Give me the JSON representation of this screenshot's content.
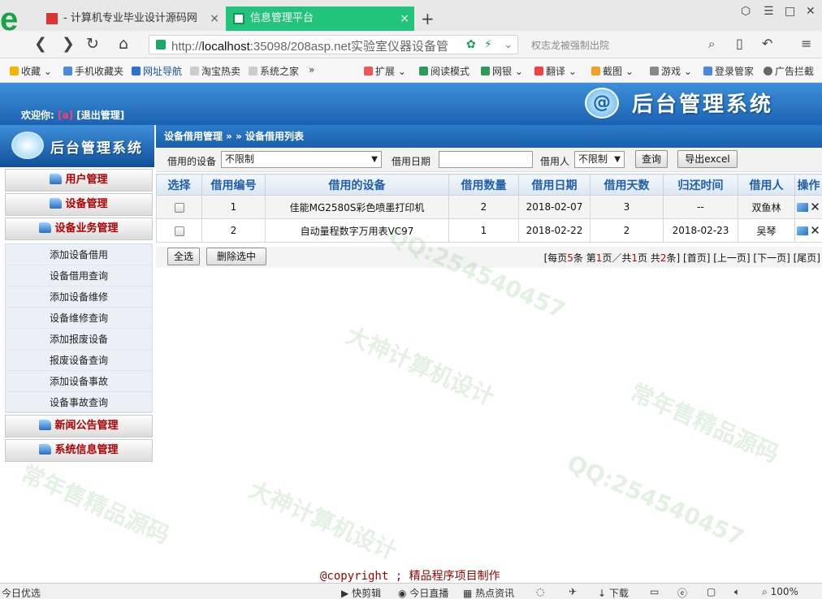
{
  "browser": {
    "tabs": [
      {
        "label": "- 计算机专业毕业设计源码网",
        "close": "×"
      },
      {
        "label": "信息管理平台",
        "close": "×"
      }
    ],
    "new_tab": "+",
    "address_prefix": "http://",
    "address_host": "localhost",
    "address_rest": ":35098/208asp.net实验室仪器设备管",
    "search_hint": "权志龙被强制出院",
    "bookmarks": [
      "收藏",
      "手机收藏夹",
      "网址导航",
      "淘宝热卖",
      "系统之家",
      "»",
      "扩展",
      "阅读模式",
      "网银",
      "翻译",
      "截图",
      "游戏",
      "登录管家",
      "广告拦截"
    ]
  },
  "banner": {
    "welcome": "欢迎你:",
    "user": "[a]",
    "logout": "[退出管理]",
    "logo_glyph": "@",
    "title": "后台管理系统"
  },
  "sidebar": {
    "head_title": "后台管理系统",
    "menus": [
      "用户管理",
      "设备管理",
      "设备业务管理",
      "新闻公告管理",
      "系统信息管理"
    ],
    "subitems": [
      "添加设备借用",
      "设备借用查询",
      "添加设备维修",
      "设备维修查询",
      "添加报废设备",
      "报废设备查询",
      "添加设备事故",
      "设备事故查询"
    ]
  },
  "main": {
    "breadcrumb": "设备借用管理 » » 设备借用列表",
    "filter": {
      "device_label": "借用的设备",
      "device_value": "不限制",
      "date_label": "借用日期",
      "date_value": "",
      "borrower_label": "借用人",
      "borrower_value": "不限制",
      "query_button": "查询",
      "export_button": "导出excel"
    },
    "table": {
      "headers": [
        "选择",
        "借用编号",
        "借用的设备",
        "借用数量",
        "借用日期",
        "借用天数",
        "归还时间",
        "借用人",
        "操作"
      ],
      "rows": [
        {
          "id": "1",
          "device": "佳能MG2580S彩色喷墨打印机",
          "qty": "2",
          "date": "2018-02-07",
          "days": "3",
          "return": "--",
          "borrower": "双鱼林"
        },
        {
          "id": "2",
          "device": "自动量程数字万用表VC97",
          "qty": "1",
          "date": "2018-02-22",
          "days": "2",
          "return": "2018-02-23",
          "borrower": "吴琴"
        }
      ]
    },
    "select_all": "全选",
    "delete_selected": "删除选中",
    "pager": {
      "p1": "[每页",
      "per_page": "5",
      "p2": "条 第",
      "current": "1",
      "p3": "页／共",
      "total_pages": "1",
      "p4": "页 共",
      "total": "2",
      "p5": "条]",
      "links": [
        "[首页]",
        "[上一页]",
        "[下一页]",
        "[尾页]"
      ]
    }
  },
  "footer": {
    "copyright": "@copyright ;",
    "maker": "精品程序项目制作"
  },
  "watermarks": [
    "大神计算机设计",
    "QQ:254540457",
    "常年售精品源码"
  ],
  "statusbar": {
    "left": "今日优选",
    "items": [
      "快剪辑",
      "今日直播",
      "热点资讯",
      "下载"
    ],
    "zoom": "100%"
  }
}
